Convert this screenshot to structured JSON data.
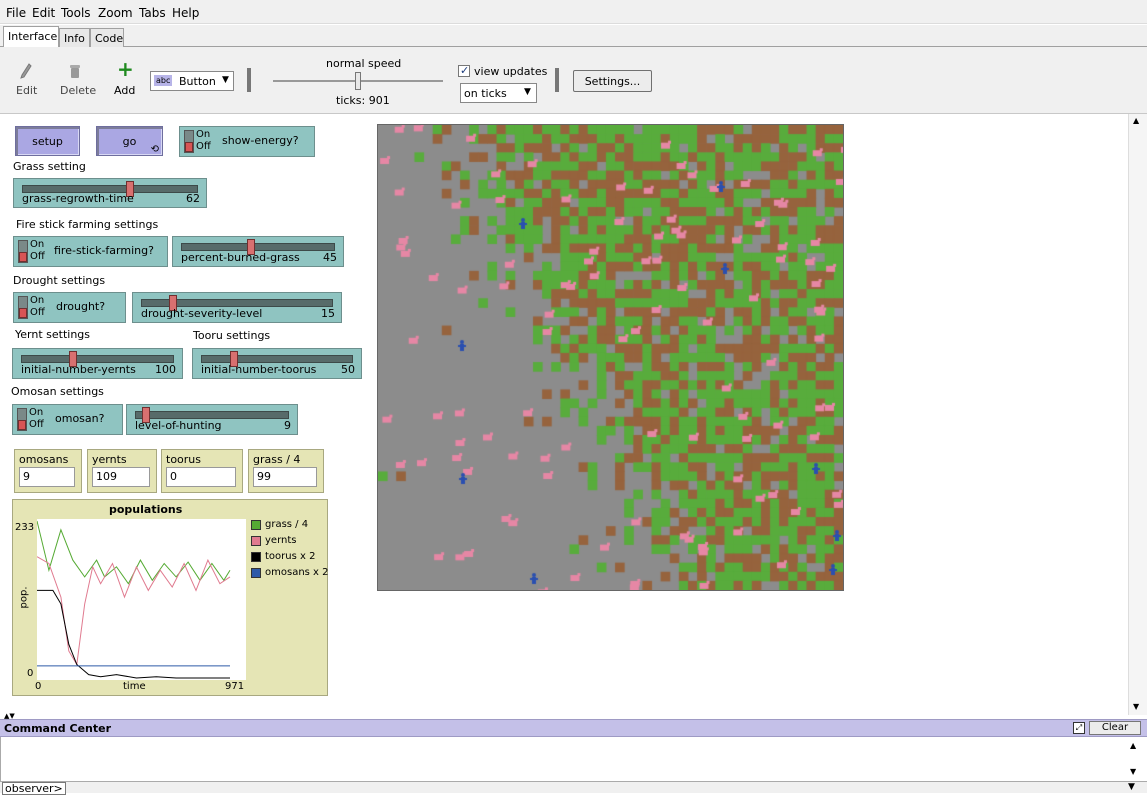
{
  "menu": [
    "File",
    "Edit",
    "Tools",
    "Zoom",
    "Tabs",
    "Help"
  ],
  "tabs": [
    "Interface",
    "Info",
    "Code"
  ],
  "toolbar": {
    "edit": "Edit",
    "delete": "Delete",
    "add": "Add",
    "widget_type": "Button",
    "widget_type_badge": "abc",
    "speed_label": "normal speed",
    "ticks_label": "ticks: 901",
    "speed_fraction": 0.5,
    "view_updates_label": "view updates",
    "view_updates_checked": true,
    "update_mode": "on ticks",
    "settings": "Settings..."
  },
  "buttons": {
    "setup": "setup",
    "go": "go"
  },
  "switch_text": {
    "on": "On",
    "off": "Off"
  },
  "notes": {
    "grass": "Grass setting",
    "fire": "Fire stick farming settings",
    "drought": "Drought settings",
    "yernt": "Yernt settings",
    "tooru": "Tooru settings",
    "omosan": "Omosan settings"
  },
  "switches": {
    "show_energy": {
      "label": "show-energy?",
      "on": false
    },
    "fire_stick": {
      "label": "fire-stick-farming?",
      "on": false
    },
    "drought": {
      "label": "drought?",
      "on": false
    },
    "omosan": {
      "label": "omosan?",
      "on": false
    }
  },
  "sliders": {
    "grass_regrowth": {
      "label": "grass-regrowth-time",
      "value": "62",
      "fraction": 0.62
    },
    "percent_burned": {
      "label": "percent-burned-grass",
      "value": "45",
      "fraction": 0.45
    },
    "drought_severity": {
      "label": "drought-severity-level",
      "value": "15",
      "fraction": 0.15
    },
    "initial_yernts": {
      "label": "initial-number-yernts",
      "value": "100",
      "fraction": 0.33
    },
    "initial_toorus": {
      "label": "initial-number-toorus",
      "value": "50",
      "fraction": 0.2
    },
    "level_hunting": {
      "label": "level-of-hunting",
      "value": "9",
      "fraction": 0.05
    }
  },
  "monitors": [
    {
      "label": "omosans",
      "value": "9"
    },
    {
      "label": "yernts",
      "value": "109"
    },
    {
      "label": "toorus",
      "value": "0"
    },
    {
      "label": "grass / 4",
      "value": "99"
    }
  ],
  "plot": {
    "title": "populations",
    "y_max_label": "233",
    "y_min_label": "0",
    "x_min_label": "0",
    "x_max_label": "971",
    "x_axis_label": "time",
    "y_axis_label": "pop.",
    "colors": {
      "grass": "#55aa33",
      "yernts": "#e07a8f",
      "toorus": "#000000",
      "omosans": "#2d5aa8"
    }
  },
  "chart_data": {
    "type": "line",
    "title": "populations",
    "xlabel": "time",
    "ylabel": "pop.",
    "xlim": [
      0,
      971
    ],
    "ylim": [
      0,
      233
    ],
    "legend": "right",
    "grid": false,
    "series": [
      {
        "name": "grass / 4",
        "color": "#55aa33",
        "x": [
          0,
          60,
          120,
          180,
          240,
          300,
          340,
          400,
          460,
          520,
          580,
          640,
          700,
          760,
          820,
          880,
          940,
          971
        ],
        "y": [
          233,
          160,
          220,
          175,
          150,
          175,
          150,
          165,
          140,
          175,
          145,
          170,
          150,
          172,
          145,
          170,
          145,
          160
        ]
      },
      {
        "name": "yernts",
        "color": "#e07a8f",
        "x": [
          0,
          60,
          120,
          160,
          200,
          240,
          280,
          320,
          380,
          440,
          500,
          560,
          620,
          680,
          740,
          800,
          860,
          920,
          971
        ],
        "y": [
          180,
          170,
          120,
          40,
          20,
          110,
          165,
          140,
          170,
          120,
          165,
          130,
          160,
          135,
          170,
          130,
          175,
          140,
          150
        ]
      },
      {
        "name": "toorus x 2",
        "color": "#000000",
        "x": [
          0,
          80,
          120,
          160,
          200,
          260,
          320,
          400,
          500,
          600,
          700,
          800,
          900,
          971
        ],
        "y": [
          130,
          130,
          110,
          50,
          20,
          5,
          2,
          5,
          0,
          2,
          0,
          0,
          0,
          0
        ]
      },
      {
        "name": "omosans x 2",
        "color": "#2d5aa8",
        "x": [
          0,
          971
        ],
        "y": [
          18,
          18
        ]
      }
    ]
  },
  "command_center": {
    "title": "Command Center",
    "clear": "Clear",
    "prompt": "observer>"
  }
}
